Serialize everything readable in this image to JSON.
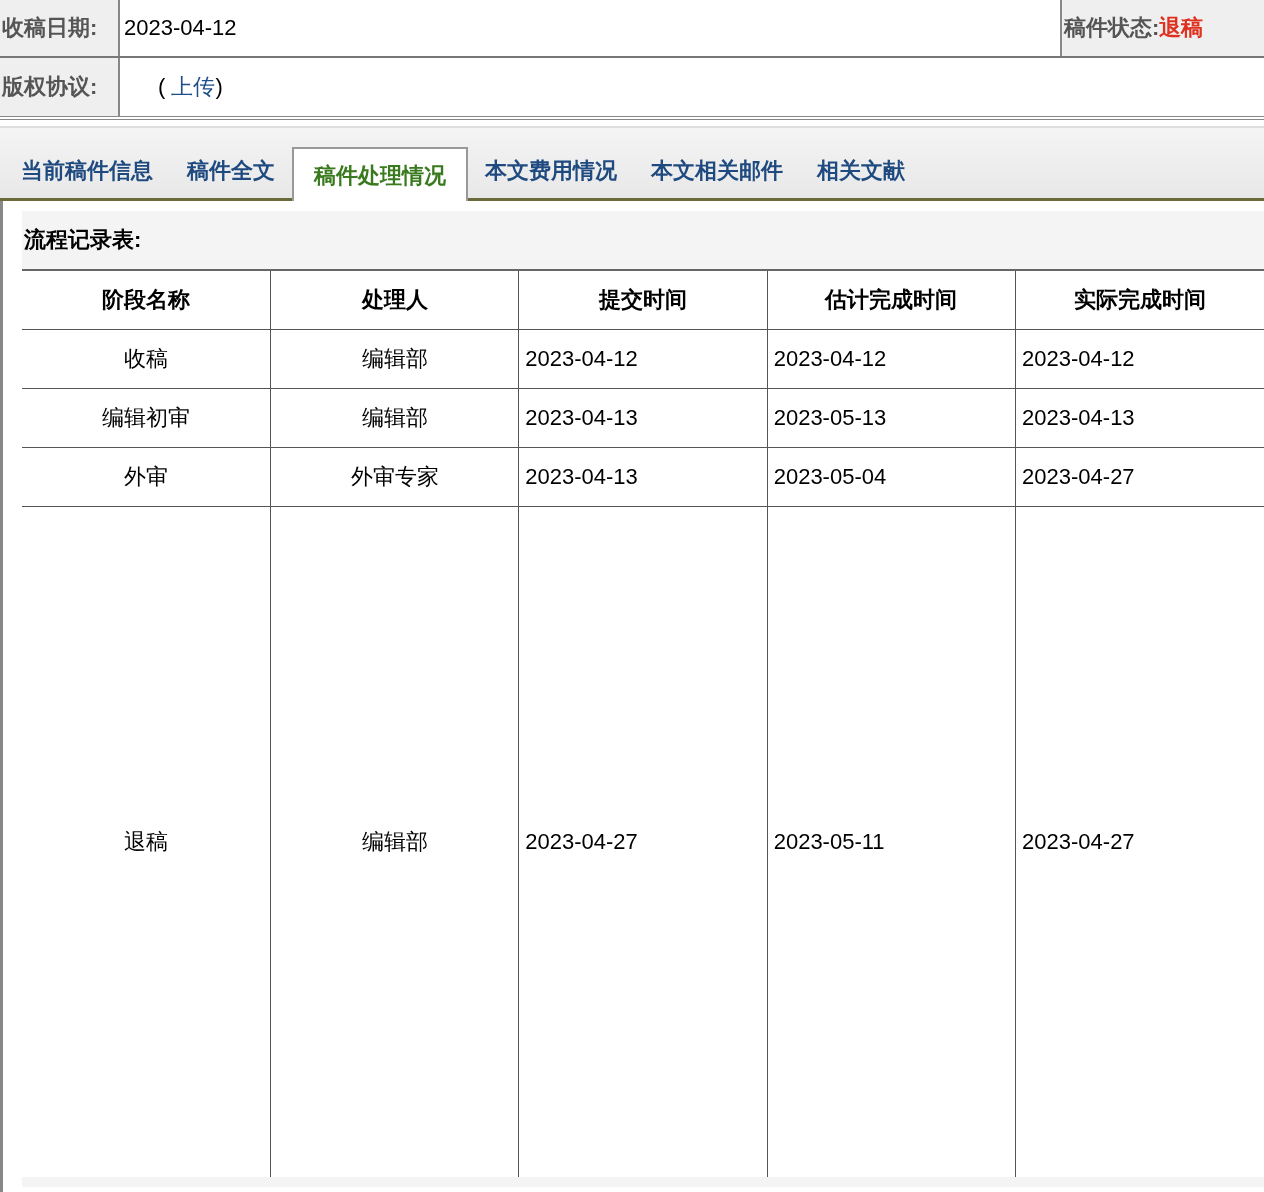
{
  "info": {
    "received_label": "收稿日期:",
    "received_value": "2023-04-12",
    "status_label": "稿件状态:",
    "status_value": "退稿",
    "copyright_label": "版权协议:",
    "copyright_open": "(",
    "upload_link": "上传",
    "copyright_close": ")"
  },
  "tabs": [
    {
      "label": "当前稿件信息",
      "selected": false
    },
    {
      "label": "稿件全文",
      "selected": false
    },
    {
      "label": "稿件处理情况",
      "selected": true
    },
    {
      "label": "本文费用情况",
      "selected": false
    },
    {
      "label": "本文相关邮件",
      "selected": false
    },
    {
      "label": "相关文献",
      "selected": false
    }
  ],
  "panel": {
    "title": "流程记录表:"
  },
  "table": {
    "columns": [
      "阶段名称",
      "处理人",
      "提交时间",
      "估计完成时间",
      "实际完成时间"
    ],
    "rows": [
      [
        "收稿",
        "编辑部",
        "2023-04-12",
        "2023-04-12",
        "2023-04-12"
      ],
      [
        "编辑初审",
        "编辑部",
        "2023-04-13",
        "2023-05-13",
        "2023-04-13"
      ],
      [
        "外审",
        "外审专家",
        "2023-04-13",
        "2023-05-04",
        "2023-04-27"
      ],
      [
        "退稿",
        "编辑部",
        "2023-04-27",
        "2023-05-11",
        "2023-04-27"
      ]
    ]
  }
}
